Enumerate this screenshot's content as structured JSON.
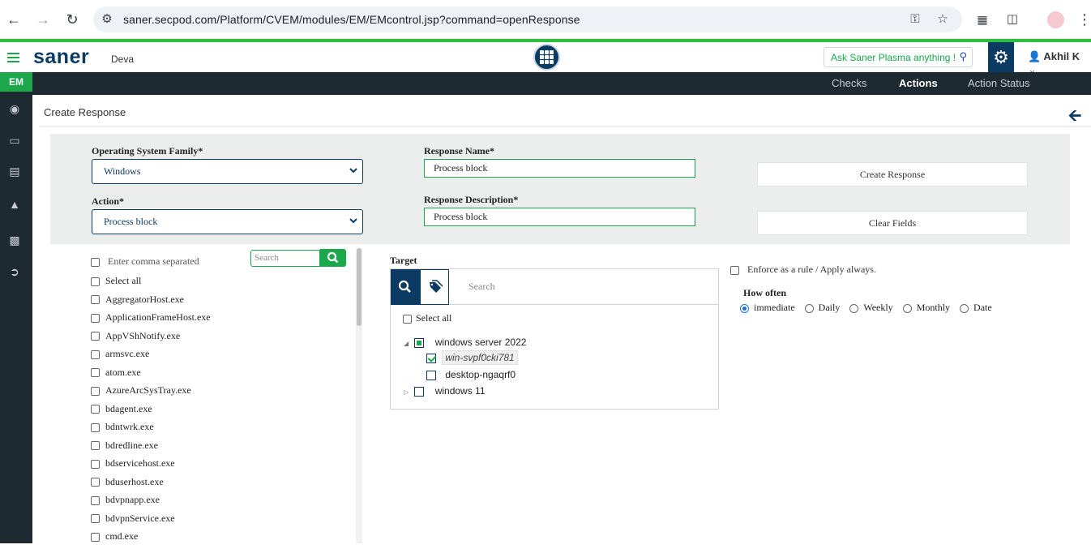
{
  "browser": {
    "url": "saner.secpod.com/Platform/CVEM/modules/EM/EMcontrol.jsp?command=openResponse"
  },
  "header": {
    "logo": "saner",
    "org": "Deva",
    "plasma_placeholder": "Ask Saner Plasma anything !",
    "user": "Akhil K"
  },
  "topnav": {
    "tabs": [
      {
        "label": "Checks"
      },
      {
        "label": "Actions"
      },
      {
        "label": "Action Status"
      }
    ]
  },
  "sidebar": {
    "module": "EM"
  },
  "page": {
    "title": "Create Response"
  },
  "form": {
    "os_label": "Operating System Family*",
    "os_value": "Windows",
    "action_label": "Action*",
    "action_value": "Process block",
    "name_label": "Response Name*",
    "name_value": "Process block",
    "desc_label": "Response Description*",
    "desc_value": "Process block",
    "create_btn": "Create Response",
    "clear_btn": "Clear Fields"
  },
  "process_list": {
    "comma_label": "Enter comma separated",
    "search_placeholder": "Search",
    "select_all": "Select all",
    "items": [
      "AggregatorHost.exe",
      "ApplicationFrameHost.exe",
      "AppVShNotify.exe",
      "armsvc.exe",
      "atom.exe",
      "AzureArcSysTray.exe",
      "bdagent.exe",
      "bdntwrk.exe",
      "bdredline.exe",
      "bdservicehost.exe",
      "bduserhost.exe",
      "bdvpnapp.exe",
      "bdvpnService.exe",
      "cmd.exe"
    ]
  },
  "target": {
    "label": "Target",
    "search_placeholder": "Search",
    "select_all": "Select all",
    "groups": [
      {
        "name": "windows server 2022",
        "children": [
          "win-svpf0cki781",
          "desktop-ngaqrf0"
        ]
      },
      {
        "name": "windows 11"
      }
    ]
  },
  "rules": {
    "enforce_label": "Enforce as a rule / Apply always.",
    "how_often_label": "How often",
    "options": [
      "immediate",
      "Daily",
      "Weekly",
      "Monthly",
      "Date"
    ],
    "selected": "immediate"
  }
}
